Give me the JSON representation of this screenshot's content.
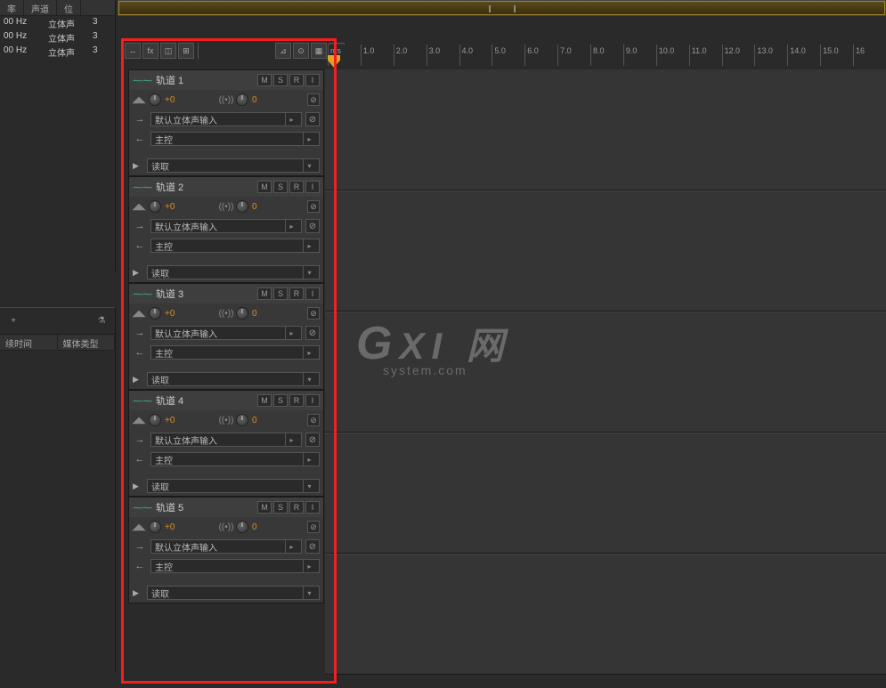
{
  "leftPanel": {
    "headers": [
      "率",
      "声道",
      "位"
    ],
    "rows": [
      {
        "hz": "00 Hz",
        "ch": "立体声",
        "b": "3"
      },
      {
        "hz": "00 Hz",
        "ch": "立体声",
        "b": "3"
      },
      {
        "hz": "00 Hz",
        "ch": "立体声",
        "b": "3"
      }
    ]
  },
  "leftLower": {
    "headers": [
      "续时间",
      "媒体类型"
    ],
    "addIcon": "+",
    "filterIcon": "⚗"
  },
  "ruler": {
    "labels": [
      "ms",
      "1.0",
      "2.0",
      "3.0",
      "4.0",
      "5.0",
      "6.0",
      "7.0",
      "8.0",
      "9.0",
      "10.0",
      "11.0",
      "12.0",
      "13.0",
      "14.0",
      "15.0",
      "16"
    ]
  },
  "toolbar": {
    "items": [
      "↔",
      "fx",
      "◫",
      "⊞",
      "≡",
      "⊿",
      "⊙",
      "▦",
      "⫾"
    ]
  },
  "tracks": [
    {
      "name": "轨道 1",
      "mute": "M",
      "solo": "S",
      "rec": "R",
      "input_mon": "I",
      "vol": "+0",
      "pan": "0",
      "input": "默认立体声输入",
      "output": "主控",
      "automation": "读取"
    },
    {
      "name": "轨道 2",
      "mute": "M",
      "solo": "S",
      "rec": "R",
      "input_mon": "I",
      "vol": "+0",
      "pan": "0",
      "input": "默认立体声输入",
      "output": "主控",
      "automation": "读取"
    },
    {
      "name": "轨道 3",
      "mute": "M",
      "solo": "S",
      "rec": "R",
      "input_mon": "I",
      "vol": "+0",
      "pan": "0",
      "input": "默认立体声输入",
      "output": "主控",
      "automation": "读取"
    },
    {
      "name": "轨道 4",
      "mute": "M",
      "solo": "S",
      "rec": "R",
      "input_mon": "I",
      "vol": "+0",
      "pan": "0",
      "input": "默认立体声输入",
      "output": "主控",
      "automation": "读取"
    },
    {
      "name": "轨道 5",
      "mute": "M",
      "solo": "S",
      "rec": "R",
      "input_mon": "I",
      "vol": "+0",
      "pan": "0",
      "input": "默认立体声输入",
      "output": "主控",
      "automation": "读取"
    }
  ],
  "watermark": {
    "main": "GXI网",
    "sub": "system.com"
  }
}
